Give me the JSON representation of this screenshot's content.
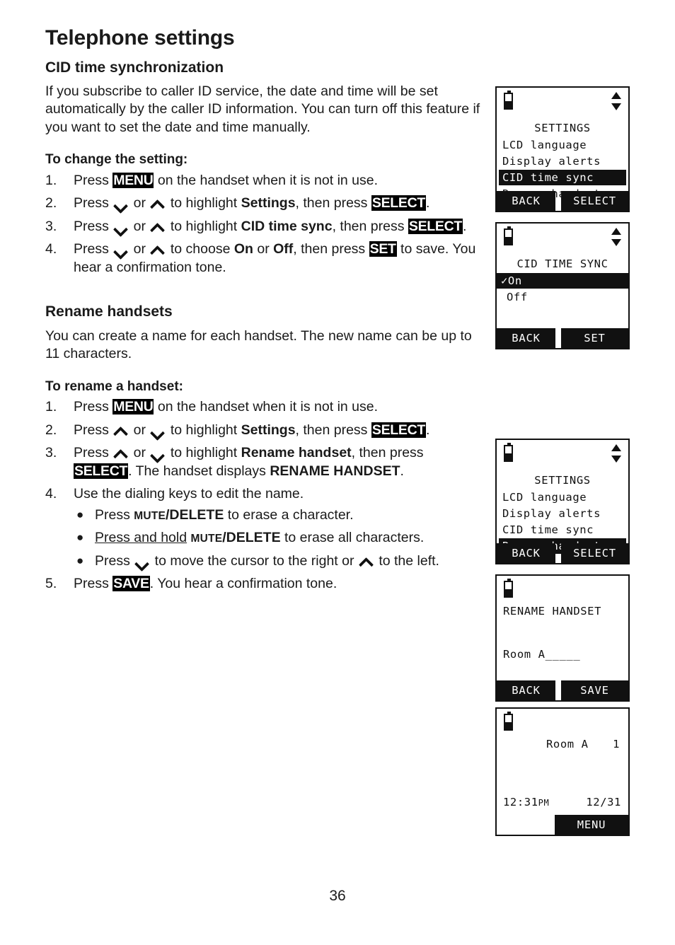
{
  "page": {
    "number": "36",
    "chapter_title": "Telephone settings"
  },
  "sections": [
    {
      "heading": "CID time synchronization",
      "intro": "If you subscribe to caller ID service, the date and time will be set automatically by the caller ID information. You can turn off this feature if you want to set the date and time manually.",
      "subhead": "To change the setting:",
      "steps": {
        "s1_num": "1.",
        "s1_a": "Press ",
        "s1_key": "MENU",
        "s1_b": " on the handset when it is not in use.",
        "s2_num": "2.",
        "s2_a": "Press ",
        "s2_or": " or ",
        "s2_b": " to highlight ",
        "s2_bold": "Settings",
        "s2_c": ", then press ",
        "s2_key": "SELECT",
        "s2_d": ".",
        "s3_num": "3.",
        "s3_a": "Press ",
        "s3_or": " or ",
        "s3_b": " to highlight ",
        "s3_bold": "CID time sync",
        "s3_c": ", then press ",
        "s3_key": "SELECT",
        "s3_d": ".",
        "s4_num": "4.",
        "s4_a": "Press ",
        "s4_or": " or ",
        "s4_b": " to choose ",
        "s4_bold1": "On",
        "s4_mid": " or ",
        "s4_bold2": "Off",
        "s4_c": ", then press ",
        "s4_key": "SET",
        "s4_d": " to save. You hear a confirmation tone."
      }
    },
    {
      "heading": "Rename handsets",
      "intro": "You can create a name for each handset. The new name can be up to 11 characters.",
      "subhead": "To rename a handset:",
      "steps": {
        "s1_num": "1.",
        "s1_a": "Press ",
        "s1_key": "MENU",
        "s1_b": " on the handset when it is not in use.",
        "s2_num": "2.",
        "s2_a": "Press ",
        "s2_or": " or ",
        "s2_b": " to highlight ",
        "s2_bold": "Settings",
        "s2_c": ", then press ",
        "s2_key": "SELECT",
        "s2_d": ".",
        "s3_num": "3.",
        "s3_a": "Press ",
        "s3_or": " or ",
        "s3_b": " to highlight ",
        "s3_bold": "Rename handset",
        "s3_c": ", then press ",
        "s3_key": "SELECT",
        "s3_d": ". The handset displays ",
        "s3_bold2": "RENAME HANDSET",
        "s3_e": ".",
        "s4_num": "4.",
        "s4_text": "Use the dialing keys to edit the name.",
        "b1_a": "Press ",
        "b1_sc": "MUTE",
        "b1_bold": "/DELETE",
        "b1_b": " to erase a character.",
        "b2_u": "Press and hold",
        "b2_sp": " ",
        "b2_sc": "MUTE",
        "b2_bold": "/DELETE",
        "b2_b": " to erase all characters.",
        "b3_a": "Press ",
        "b3_b": " to move the cursor to the right or ",
        "b3_c": " to the left.",
        "s5_num": "5.",
        "s5_a": "Press ",
        "s5_key": "SAVE",
        "s5_b": ". You hear a confirmation tone."
      }
    }
  ],
  "lcd_screens": [
    {
      "id": "settings-cid-time-sync",
      "title": "SETTINGS",
      "items": [
        "LCD language",
        "Display alerts",
        "CID time sync",
        "Rename handset"
      ],
      "highlighted_index": 2,
      "softkey_left": "BACK",
      "softkey_right": "SELECT",
      "battery_icon": "battery-icon",
      "scroll_icon": "scroll-up-down-icon"
    },
    {
      "id": "cid-time-sync-options",
      "title": "CID TIME SYNC",
      "items": [
        "✓On",
        "Off"
      ],
      "highlighted_index": 0,
      "softkey_left": "BACK",
      "softkey_right": "SET",
      "battery_icon": "battery-icon",
      "scroll_icon": "scroll-up-down-icon"
    },
    {
      "id": "settings-rename-handset",
      "title": "SETTINGS",
      "items": [
        "LCD language",
        "Display alerts",
        "CID time sync",
        "Rename handset"
      ],
      "highlighted_index": 3,
      "softkey_left": "BACK",
      "softkey_right": "SELECT",
      "battery_icon": "battery-icon",
      "scroll_icon": "scroll-up-down-icon"
    },
    {
      "id": "rename-handset-editor",
      "title": "RENAME HANDSET",
      "value": "Room A_____",
      "softkey_left": "BACK",
      "softkey_right": "SAVE",
      "battery_icon": "battery-icon"
    },
    {
      "id": "handset-idle",
      "name": "Room A",
      "handset_number": "1",
      "time": "12:31",
      "time_suffix": "PM",
      "date": "12/31",
      "softkey_right": "MENU",
      "battery_icon": "battery-icon"
    }
  ],
  "colors": {
    "ink": "#111111",
    "paper": "#ffffff"
  }
}
